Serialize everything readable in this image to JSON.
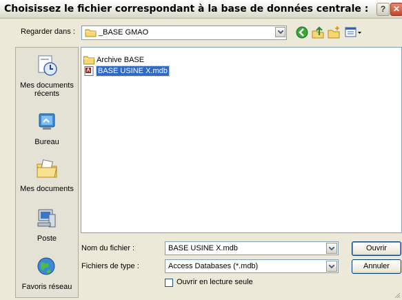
{
  "dialog": {
    "title": "Choisissez le fichier correspondant à la base de données centrale :"
  },
  "lookin": {
    "label": "Regarder dans :",
    "value": "_BASE GMAO"
  },
  "places": [
    {
      "label": "Mes documents récents"
    },
    {
      "label": "Bureau"
    },
    {
      "label": "Mes documents"
    },
    {
      "label": "Poste"
    },
    {
      "label": "Favoris réseau"
    }
  ],
  "files": [
    {
      "name": "Archive BASE",
      "type": "folder"
    },
    {
      "name": "BASE USINE X.mdb",
      "type": "mdb",
      "selected": true
    }
  ],
  "filename": {
    "label": "Nom du fichier :",
    "value": "BASE USINE X.mdb"
  },
  "filetype": {
    "label": "Fichiers de type :",
    "value": "Access Databases (*.mdb)"
  },
  "buttons": {
    "open": "Ouvrir",
    "cancel": "Annuler"
  },
  "readonly": {
    "label": "Ouvrir en lecture seule",
    "checked": false
  },
  "colors": {
    "selection": "#316ac5",
    "dialog_bg": "#ece9d8"
  }
}
